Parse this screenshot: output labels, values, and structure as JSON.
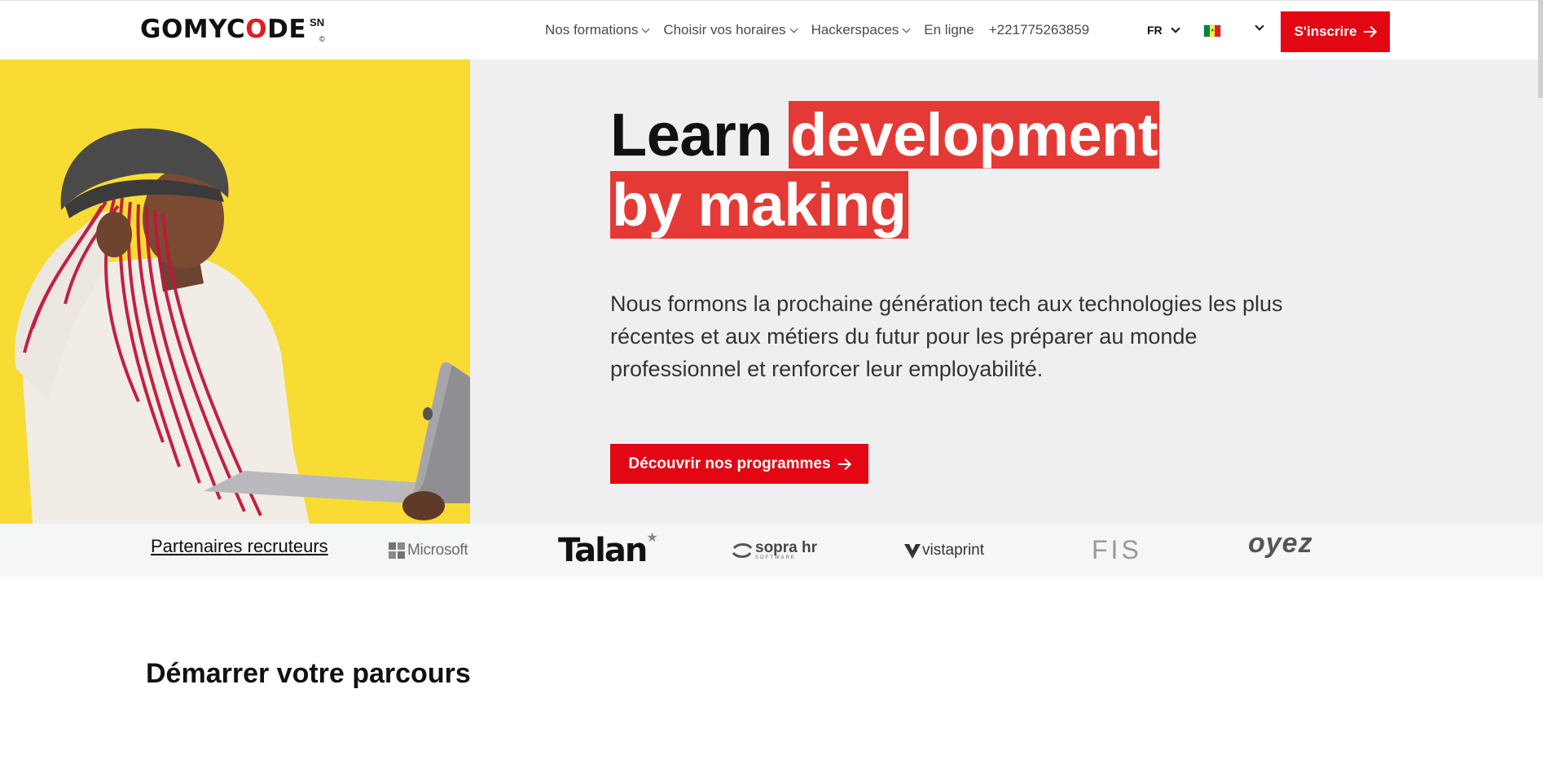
{
  "header": {
    "logo": {
      "text_before": "GOMYC",
      "text_o": "O",
      "text_after": "DE",
      "country": "SN",
      "copyright": "©"
    },
    "nav": [
      {
        "label": "Nos formations",
        "has_dropdown": true
      },
      {
        "label": "Choisir vos horaires",
        "has_dropdown": true
      },
      {
        "label": "Hackerspaces",
        "has_dropdown": true
      },
      {
        "label": "En ligne",
        "has_dropdown": false
      },
      {
        "label": "+221775263859",
        "has_dropdown": false
      }
    ],
    "language": "FR",
    "country_flag": "senegal-flag-icon",
    "signup_label": "S'inscrire"
  },
  "hero": {
    "headline_plain": "Learn ",
    "headline_highlight_1": "development",
    "headline_highlight_2": " by making",
    "description": "Nous formons la prochaine génération tech aux technologies les plus récentes et aux métiers du futur pour les préparer au monde professionnel et renforcer leur employabilité.",
    "cta_label": "Découvrir nos programmes"
  },
  "partners": {
    "title": "Partenaires recruteurs",
    "logos": [
      {
        "name": "Microsoft"
      },
      {
        "name": "Talan"
      },
      {
        "name": "sopra hr",
        "sub": "SOFTWARE"
      },
      {
        "name": "vistaprint"
      },
      {
        "name": "FIS"
      },
      {
        "name": "oyez"
      }
    ]
  },
  "section": {
    "title": "Démarrer votre parcours"
  },
  "colors": {
    "accent": "#e30613",
    "hero_bg": "#efeff1",
    "hero_img_bg": "#f8dc33",
    "partners_bg": "#f5f6f6"
  }
}
